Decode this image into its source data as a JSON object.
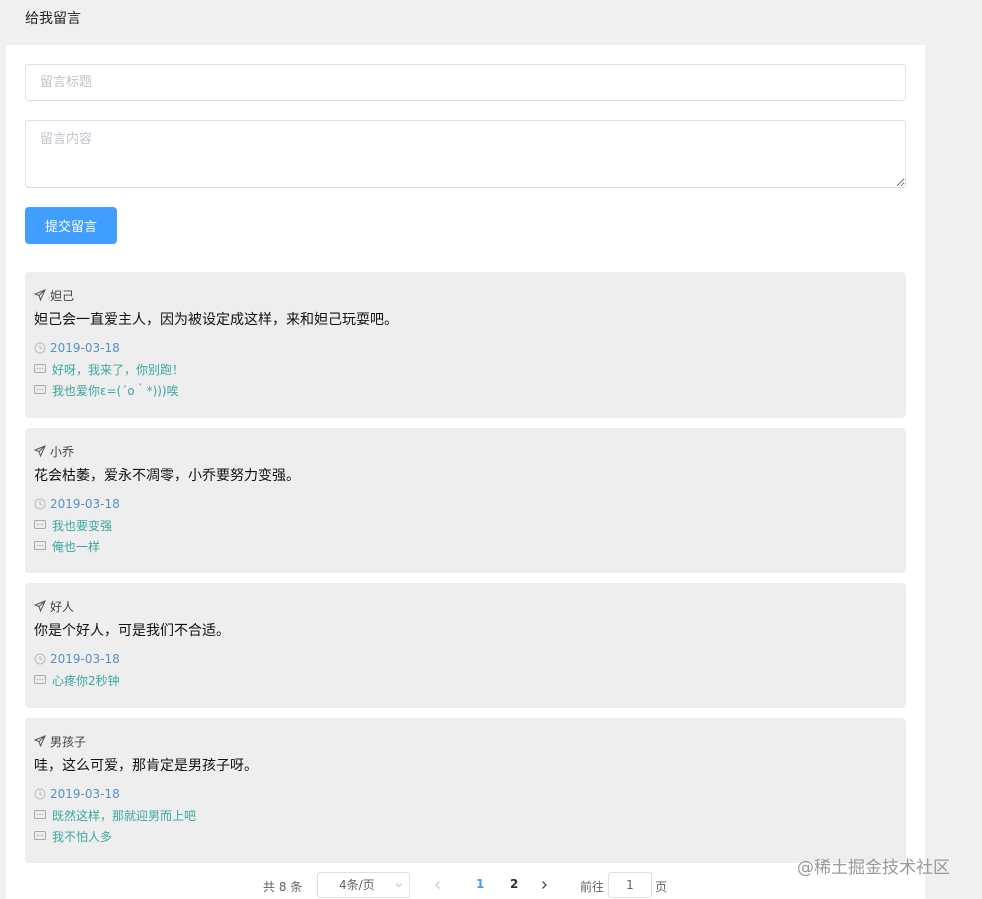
{
  "page": {
    "title": "给我留言"
  },
  "form": {
    "title_placeholder": "留言标题",
    "content_placeholder": "留言内容",
    "submit_label": "提交留言"
  },
  "messages": [
    {
      "author": "妲己",
      "content": "妲己会一直爱主人，因为被设定成这样，来和妲己玩耍吧。",
      "date": "2019-03-18",
      "replies": [
        "好呀，我来了，你别跑！",
        "我也爱你ε=(´ο｀*)))唉"
      ]
    },
    {
      "author": "小乔",
      "content": "花会枯萎，爱永不凋零，小乔要努力变强。",
      "date": "2019-03-18",
      "replies": [
        "我也要变强",
        "俺也一样"
      ]
    },
    {
      "author": "好人",
      "content": "你是个好人，可是我们不合适。",
      "date": "2019-03-18",
      "replies": [
        "心疼你2秒钟"
      ]
    },
    {
      "author": "男孩子",
      "content": "哇，这么可爱，那肯定是男孩子呀。",
      "date": "2019-03-18",
      "replies": [
        "既然这样，那就迎男而上吧",
        "我不怕人多"
      ]
    }
  ],
  "pagination": {
    "total_text": "共 8 条",
    "page_size": "4条/页",
    "pages": [
      "1",
      "2"
    ],
    "current_page": "1",
    "goto_label": "前往",
    "jump_value": "1",
    "page_label": "页"
  },
  "watermark": "@稀土掘金技术社区",
  "colors": {
    "primary": "#409eff",
    "date": "#5a8fc8",
    "reply": "#3aa8a0",
    "card_bg": "#eeeeee"
  }
}
